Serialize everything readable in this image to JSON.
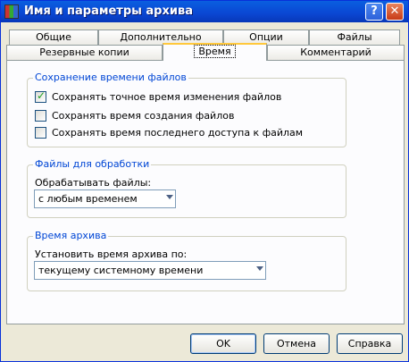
{
  "window": {
    "title": "Имя и параметры архива",
    "help_label": "?",
    "close_label": "✕"
  },
  "tabs": {
    "row1": [
      "Общие",
      "Дополнительно",
      "Опции",
      "Файлы"
    ],
    "row2": [
      "Резервные копии",
      "Время",
      "Комментарий"
    ],
    "active": "Время"
  },
  "file_time": {
    "title": "Сохранение времени файлов",
    "options": [
      {
        "label": "Сохранять точное время изменения файлов",
        "checked": true
      },
      {
        "label": "Сохранять время создания файлов",
        "checked": false
      },
      {
        "label": "Сохранять время последнего доступа к файлам",
        "checked": false
      }
    ]
  },
  "files_to_process": {
    "title": "Файлы для обработки",
    "label": "Обрабатывать файлы:",
    "value": "с любым временем"
  },
  "archive_time": {
    "title": "Время архива",
    "label": "Установить время архива по:",
    "value": "текущему системному времени"
  },
  "buttons": {
    "ok": "OK",
    "cancel": "Отмена",
    "help": "Справка"
  },
  "colors": {
    "titlebar": "#0A46D2",
    "group_title": "#0046D5",
    "active_tab_accent": "#FFC83C"
  }
}
